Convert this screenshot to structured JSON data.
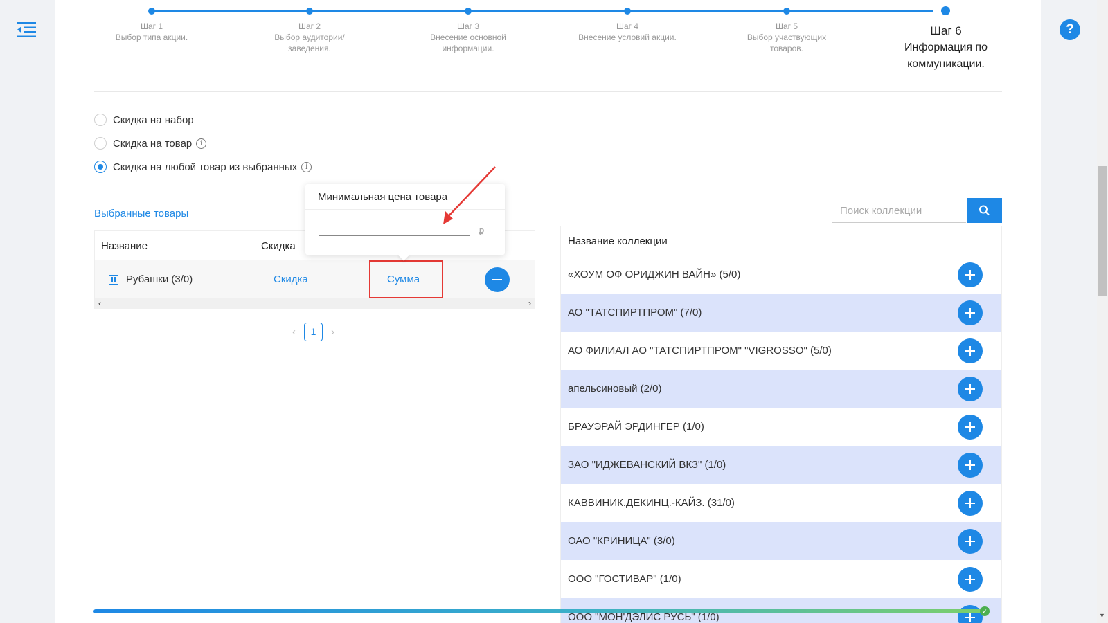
{
  "steps": [
    {
      "title": "Шаг 1",
      "desc": "Выбор типа акции."
    },
    {
      "title": "Шаг 2",
      "desc": "Выбор аудитории/заведения."
    },
    {
      "title": "Шаг 3",
      "desc": "Внесение основной информации."
    },
    {
      "title": "Шаг 4",
      "desc": "Внесение условий акции."
    },
    {
      "title": "Шаг 5",
      "desc": "Выбор участвующих товаров."
    },
    {
      "title": "Шаг 6",
      "desc": "Информация по коммуникации."
    }
  ],
  "radios": [
    {
      "label": "Скидка на набор",
      "checked": false
    },
    {
      "label": "Скидка на товар",
      "checked": false
    },
    {
      "label": "Скидка на любой товар из выбранных",
      "checked": true
    }
  ],
  "selected": {
    "title": "Выбранные товары",
    "headers": {
      "name": "Название",
      "discount": "Скидка"
    },
    "row": {
      "name": "Рубашки (3/0)",
      "discount_link": "Скидка",
      "sum_link": "Сумма"
    },
    "page": "1"
  },
  "popover": {
    "title": "Минимальная цена товара",
    "currency": "₽"
  },
  "collections": {
    "search_placeholder": "Поиск коллекции",
    "header": "Название коллекции",
    "items": [
      "«ХОУМ ОФ ОРИДЖИН ВАЙН» (5/0)",
      "АО \"ТАТСПИРТПРОМ\" (7/0)",
      "АО ФИЛИАЛ АО \"ТАТСПИРТПРОМ\" \"VIGROSSO\" (5/0)",
      "апельсиновый (2/0)",
      "БРАУЭРАЙ ЭРДИНГЕР (1/0)",
      "ЗАО \"ИДЖЕВАНСКИЙ ВКЗ\" (1/0)",
      "КАВВИНИК.ДЕКИНЦ.-КАЙЗ. (31/0)",
      "ОАО \"КРИНИЦА\" (3/0)",
      "ООО \"ГОСТИВАР\" (1/0)",
      "ООО \"МОН'ДЭЛИС РУСЬ\" (1/0)"
    ]
  },
  "help": "?"
}
